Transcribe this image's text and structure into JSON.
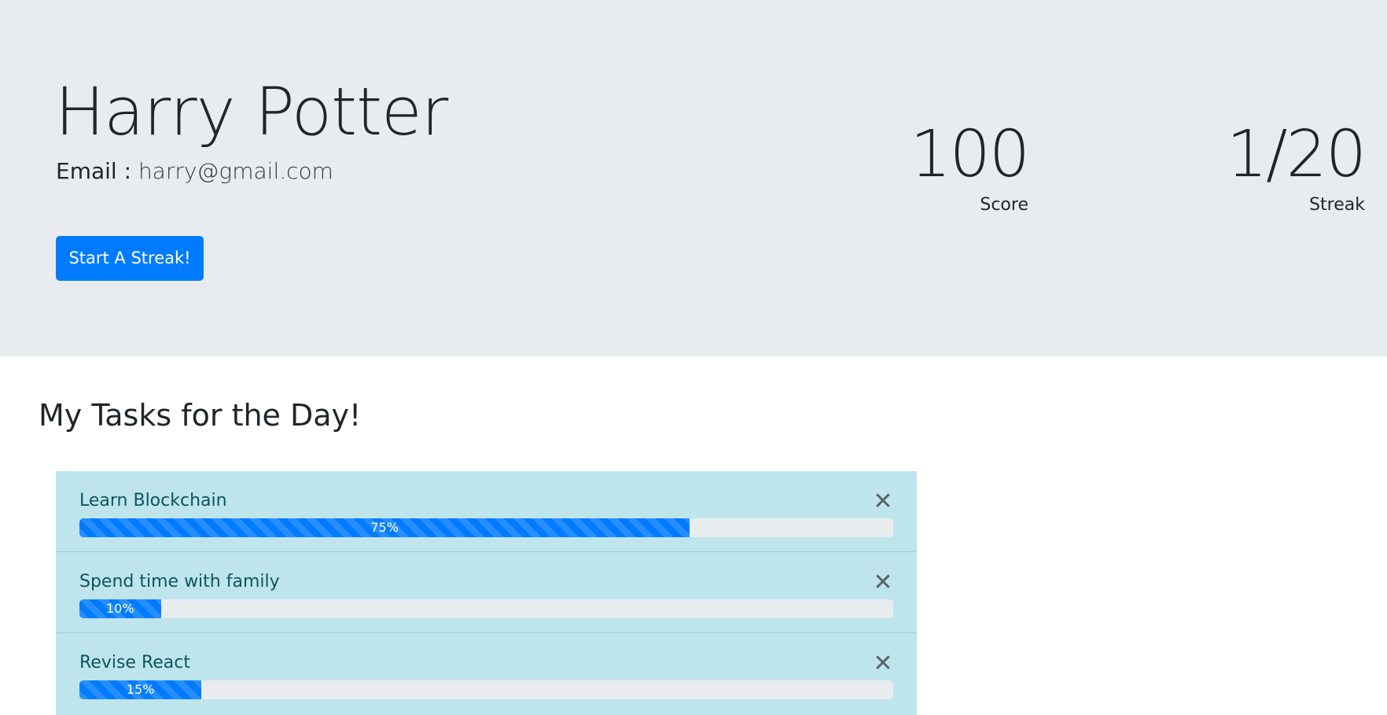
{
  "profile": {
    "name": "Harry Potter",
    "email_label": "Email :",
    "email": "harry@gmail.com",
    "start_button_label": "Start A Streak!"
  },
  "stats": {
    "score_value": "100",
    "score_label": "Score",
    "streak_value": "1/20",
    "streak_label": "Streak"
  },
  "tasks": {
    "heading": "My Tasks for the Day!",
    "items": [
      {
        "name": "Learn Blockchain",
        "progress": 75,
        "progress_label": "75%",
        "close_icon": "close-icon"
      },
      {
        "name": "Spend time with family",
        "progress": 10,
        "progress_label": "10%",
        "close_icon": "close-icon"
      },
      {
        "name": "Revise React",
        "progress": 15,
        "progress_label": "15%",
        "close_icon": "close-icon"
      }
    ]
  },
  "colors": {
    "jumbotron_bg": "#e9ecef",
    "primary": "#007bff",
    "task_bg": "#bee5eb",
    "task_text": "#0c5460"
  }
}
